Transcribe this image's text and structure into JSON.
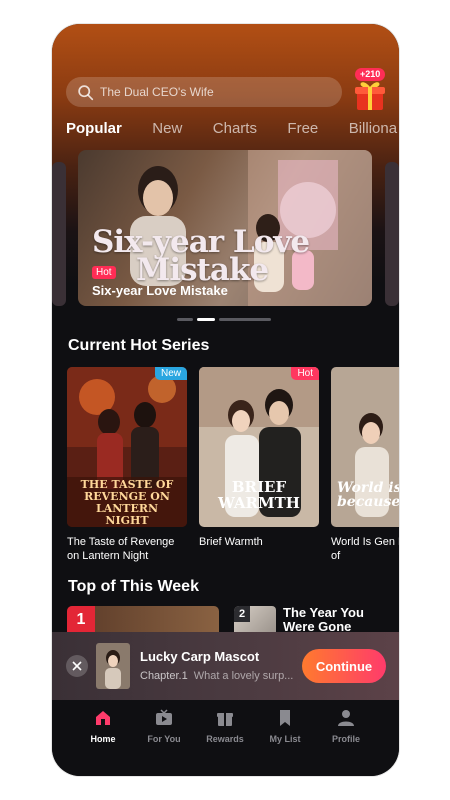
{
  "search": {
    "placeholder": "The Dual CEO's Wife"
  },
  "gift": {
    "badge": "+210"
  },
  "tabs": [
    {
      "label": "Popular",
      "active": true
    },
    {
      "label": "New"
    },
    {
      "label": "Charts"
    },
    {
      "label": "Free"
    },
    {
      "label": "Billiona"
    }
  ],
  "banner": {
    "art_title_line1": "Six-year Love",
    "art_title_line2": "Mistake",
    "tag": "Hot",
    "caption": "Six-year Love Mistake"
  },
  "sections": {
    "hot_series": "Current Hot Series",
    "top_week": "Top of This Week"
  },
  "hot_series": [
    {
      "title": "The Taste of Revenge on Lantern Night",
      "tag": "New",
      "art": "THE TASTE OF REVENGE ON LANTERN NIGHT"
    },
    {
      "title": "Brief Warmth",
      "tag": "Hot",
      "art": "BRIEF WARMTH"
    },
    {
      "title": "World Is Gen Beacause of",
      "art": "World is because"
    }
  ],
  "top_week": [
    {
      "rank": "1"
    },
    {
      "rank": "2",
      "title_line1": "The Year You",
      "title_line2": "Were Gone"
    }
  ],
  "continue": {
    "title": "Lucky Carp Mascot",
    "chapter": "Chapter.1",
    "snippet": "What a lovely surp...",
    "button": "Continue"
  },
  "nav": [
    {
      "label": "Home",
      "icon": "home-icon",
      "active": true
    },
    {
      "label": "For You",
      "icon": "tv-icon"
    },
    {
      "label": "Rewards",
      "icon": "gift-icon"
    },
    {
      "label": "My List",
      "icon": "bookmark-icon"
    },
    {
      "label": "Profile",
      "icon": "profile-icon"
    }
  ],
  "colors": {
    "accent": "#ff3b6b",
    "new_tag": "#2aa6e0",
    "hot_tag": "#ff2d55",
    "background": "#0f0f12"
  }
}
